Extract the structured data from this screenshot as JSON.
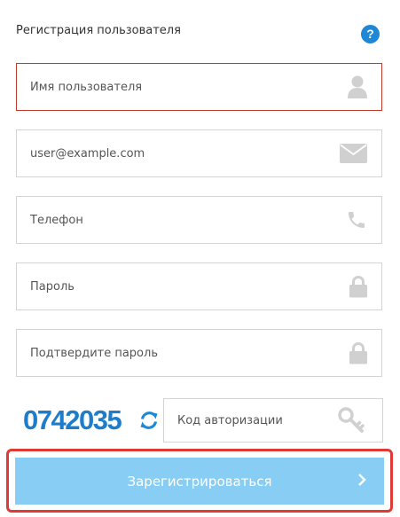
{
  "form": {
    "title": "Регистрация пользователя",
    "help_symbol": "?",
    "username_placeholder": "Имя пользователя",
    "email_placeholder": "user@example.com",
    "phone_placeholder": "Телефон",
    "password_placeholder": "Пароль",
    "confirm_password_placeholder": "Подтвердите пароль",
    "captcha_value": "0742035",
    "auth_code_placeholder": "Код авторизации",
    "submit_label": "Зарегистрироваться"
  },
  "icons": {
    "help": "help-circle-icon",
    "username": "user-icon",
    "email": "envelope-icon",
    "phone": "phone-icon",
    "password": "lock-icon",
    "confirm_password": "lock-icon",
    "captcha_refresh": "refresh-icon",
    "auth_code": "key-icon",
    "submit": "chevron-right-icon"
  },
  "colors": {
    "accent": "#1e88d6",
    "captcha": "#1e7cc8",
    "submit_bg": "#87cdf4",
    "active_border": "#c0392b",
    "highlight_border": "#e03a36",
    "icon_gray": "#d0d0d0"
  }
}
